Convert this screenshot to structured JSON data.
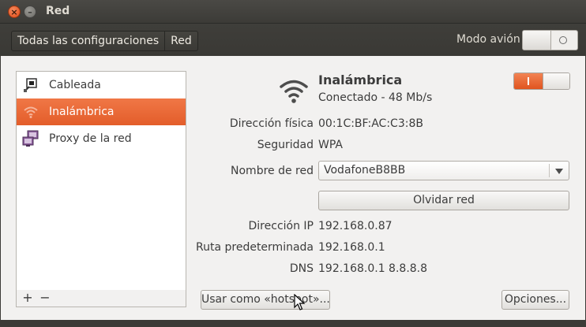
{
  "window": {
    "title": "Red",
    "close_glyph": "×",
    "minimize_glyph": "–"
  },
  "toolbar": {
    "breadcrumbs": [
      "Todas las configuraciones",
      "Red"
    ],
    "airplane_mode_label": "Modo avión",
    "airplane_mode_on": false
  },
  "sidebar": {
    "items": [
      {
        "label": "Cableada",
        "icon": "wired-network-icon",
        "active": false
      },
      {
        "label": "Inalámbrica",
        "icon": "wireless-icon",
        "active": true
      },
      {
        "label": "Proxy de la red",
        "icon": "network-proxy-icon",
        "active": false
      }
    ],
    "add_label": "+",
    "remove_label": "−"
  },
  "device": {
    "name": "Inalámbrica",
    "status": "Conectado - 48 Mb/s",
    "enabled": true,
    "hw_address_label": "Dirección física",
    "hw_address": "00:1C:BF:AC:C3:8B",
    "security_label": "Seguridad",
    "security": "WPA",
    "network_name_label": "Nombre de red",
    "network_name": "VodafoneB8BB",
    "forget_button": "Olvidar red",
    "ip_label": "Dirección IP",
    "ip": "192.168.0.87",
    "route_label": "Ruta predeterminada",
    "route": "192.168.0.1",
    "dns_label": "DNS",
    "dns": "192.168.0.1 8.8.8.8"
  },
  "actions": {
    "hotspot_button": "Usar como «hotspot»...",
    "options_button": "Opciones..."
  },
  "colors": {
    "accent": "#e95420",
    "titlebar": "#3c3b37",
    "panel": "#f2f1f0"
  }
}
